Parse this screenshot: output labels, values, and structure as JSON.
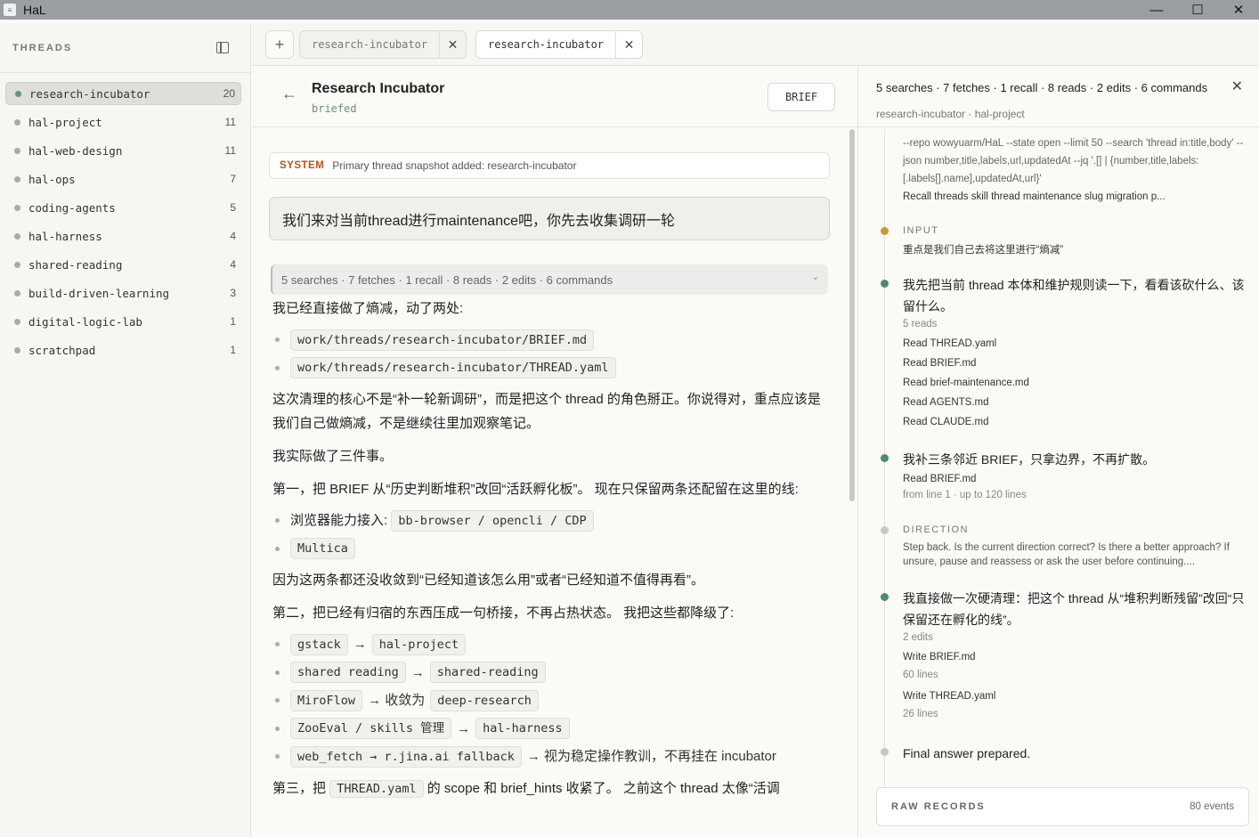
{
  "window": {
    "title": "HaL",
    "controls": [
      "—",
      "☐",
      "✕"
    ]
  },
  "sidebar": {
    "title": "THREADS",
    "items": [
      {
        "label": "research-incubator",
        "count": "20",
        "active": true
      },
      {
        "label": "hal-project",
        "count": "11"
      },
      {
        "label": "hal-web-design",
        "count": "11"
      },
      {
        "label": "hal-ops",
        "count": "7"
      },
      {
        "label": "coding-agents",
        "count": "5"
      },
      {
        "label": "hal-harness",
        "count": "4"
      },
      {
        "label": "shared-reading",
        "count": "4"
      },
      {
        "label": "build-driven-learning",
        "count": "3"
      },
      {
        "label": "digital-logic-lab",
        "count": "1"
      },
      {
        "label": "scratchpad",
        "count": "1"
      }
    ]
  },
  "tabs": [
    {
      "label": "research-incubator",
      "active": false
    },
    {
      "label": "research-incubator",
      "active": true
    }
  ],
  "header": {
    "title": "Research Incubator",
    "status": "briefed",
    "brief_button": "BRIEF"
  },
  "chat": {
    "system_tag": "SYSTEM",
    "system_text": "Primary thread snapshot added: research-incubator",
    "user_message": "我们来对当前thread进行maintenance吧，你先去收集调研一轮",
    "summary": "5 searches · 7 fetches · 1 recall · 8 reads · 2 edits · 6 commands",
    "answer": {
      "p1": "我已经直接做了熵减，动了两处:",
      "files": [
        "work/threads/research-incubator/BRIEF.md",
        "work/threads/research-incubator/THREAD.yaml"
      ],
      "p2": "这次清理的核心不是“补一轮新调研”，而是把这个 thread 的角色掰正。你说得对，重点应该是我们自己做熵减，不是继续往里加观察笔记。",
      "p3": "我实际做了三件事。",
      "p4": "第一，把 BRIEF 从“历史判断堆积”改回“活跃孵化板”。 现在只保留两条还配留在这里的线:",
      "line1_text": "浏览器能力接入:",
      "line1_code": "bb-browser / opencli / CDP",
      "line2_code": "Multica",
      "p5": "因为这两条都还没收敛到“已经知道该怎么用”或者“已经知道不值得再看”。",
      "p6": "第二，把已经有归宿的东西压成一句桥接，不再占热状态。 我把这些都降级了:",
      "mappings": [
        {
          "from": "gstack",
          "arrow": "→",
          "to": "hal-project",
          "tail": ""
        },
        {
          "from": "shared reading",
          "arrow": "→",
          "to": "shared-reading",
          "tail": ""
        },
        {
          "from": "MiroFlow",
          "arrow": "→ 收敛为",
          "to": "deep-research",
          "tail": ""
        },
        {
          "from": "ZooEval / skills 管理",
          "arrow": "→",
          "to": "hal-harness",
          "tail": ""
        },
        {
          "from": "web_fetch → r.jina.ai fallback",
          "arrow": "→ 视为稳定操作教训，不再挂在 incubator",
          "to": "",
          "tail": ""
        }
      ],
      "p7_start": "第三，把",
      "p7_code": "THREAD.yaml",
      "p7_end": "的 scope 和 brief_hints 收紧了。 之前这个 thread 太像“活调"
    }
  },
  "panel": {
    "title": "5 searches · 7 fetches · 1 recall · 8 reads · 2 edits · 6 commands",
    "subtitle": "research-incubator · hal-project",
    "cmd_text": "--repo wowyuarm/HaL --state open --limit 50 --search 'thread in:title,body' --json number,title,labels,url,updatedAt --jq '.[] | {number,title,labels:[.labels[].name],updatedAt,url}'",
    "recall_text": "Recall threads skill thread maintenance slug migration p...",
    "input_label": "INPUT",
    "input_text": "重点是我们自己去将这里进行“熵减”",
    "step1": {
      "text": "我先把当前 thread 本体和维护规则读一下，看看该砍什么、该留什么。",
      "meta": "5 reads",
      "files": [
        "Read THREAD.yaml",
        "Read BRIEF.md",
        "Read brief-maintenance.md",
        "Read AGENTS.md",
        "Read CLAUDE.md"
      ]
    },
    "step2": {
      "text": "我补三条邻近 BRIEF，只拿边界，不再扩散。",
      "file": "Read BRIEF.md",
      "meta": "from line 1 · up to 120 lines"
    },
    "direction_label": "DIRECTION",
    "direction_text": "Step back. Is the current direction correct? Is there a better approach? If unsure, pause and reassess or ask the user before continuing....",
    "step3": {
      "text": "我直接做一次硬清理：把这个 thread 从“堆积判断残留”改回“只保留还在孵化的线”。",
      "meta": "2 edits",
      "write1": "Write BRIEF.md",
      "write1_meta": "60 lines",
      "write2": "Write THREAD.yaml",
      "write2_meta": "26 lines"
    },
    "final": "Final answer prepared.",
    "raw_label": "RAW RECORDS",
    "raw_count": "80 events"
  },
  "colors": {
    "accent": "#6b8f7f",
    "system": "#b3541e",
    "amber": "#c59a3a"
  }
}
